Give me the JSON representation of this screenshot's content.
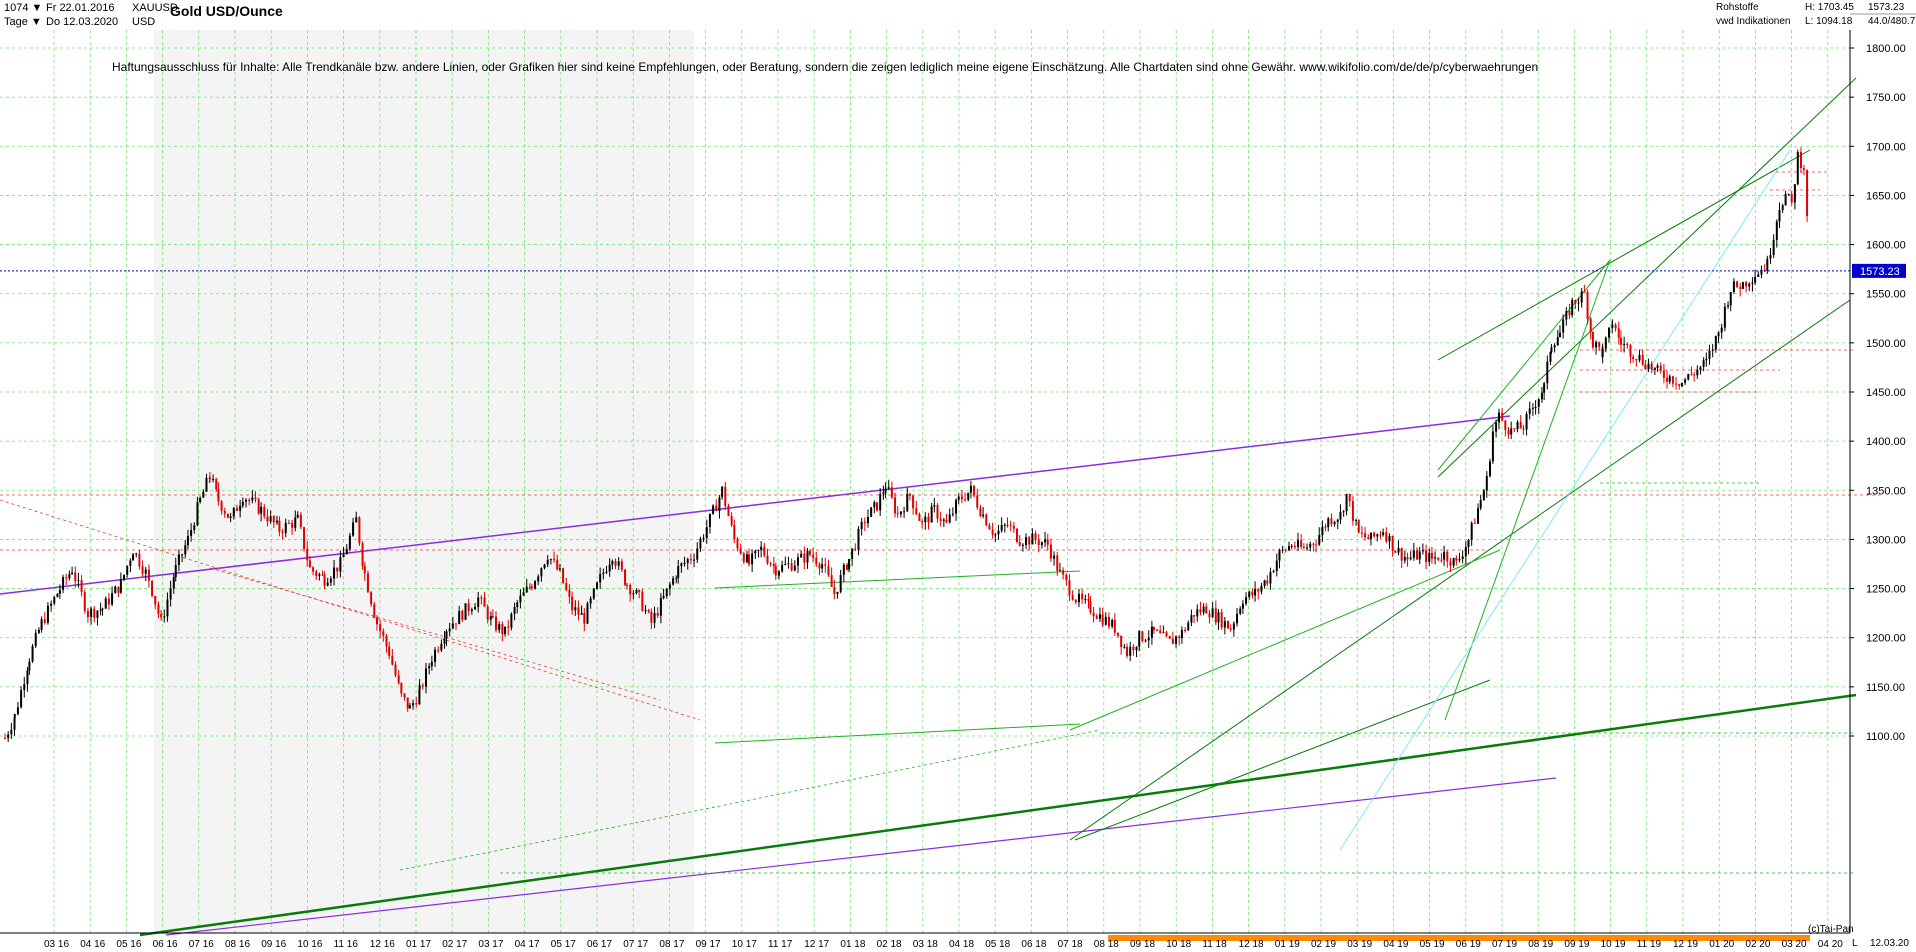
{
  "header": {
    "left": {
      "period": "1074",
      "interval": "Tage",
      "start_date": "Fr 22.01.2016",
      "end_date": "Do 12.03.2020",
      "symbol": "XAUUSD",
      "currency": "USD"
    },
    "title": "Gold USD/Ounce",
    "right": {
      "group": "Rohstoffe",
      "source": "vwd Indikationen",
      "high": "H: 1703.45",
      "low": "L: 1094.18",
      "last": "1573.23",
      "change": "44.0/480.7"
    }
  },
  "disclaimer": "Haftungsausschluss für Inhalte: Alle Trendkanäle bzw. andere Linien, oder Grafiken hier sind keine Empfehlungen, oder Beratung, sondern die zeigen lediglich meine eigene Einschätzung. Alle Chartdaten sind ohne Gewähr.  www.wikifolio.com/de/de/p/cyberwaehrungen",
  "copyright": "(c)Tai-Pan",
  "footer_date": "12.03.20",
  "axis_end_letter": "L",
  "colors": {
    "up": "#000000",
    "down": "#e00000",
    "grid": "#7ddc7d",
    "last_price_line": "#0000cc",
    "last_price_badge": "#0000cc",
    "purple": "#8b2be2",
    "green_dark": "#0a7a0a",
    "green": "#20b020",
    "cyan": "#80e8ff",
    "red_dashed": "#e04040",
    "orange_bar": "#ff8c00"
  },
  "chart_data": {
    "type": "candlestick",
    "title": "Gold USD/Ounce",
    "ylim": [
      1094.18,
      1820
    ],
    "y_ticks": [
      1100,
      1150,
      1200,
      1250,
      1300,
      1350,
      1400,
      1450,
      1500,
      1550,
      1600,
      1650,
      1700,
      1750,
      1800
    ],
    "y_tick_labels": [
      "1100.00",
      "1150.00",
      "1200.00",
      "1250.00",
      "1300.00",
      "1350.00",
      "1400.00",
      "1450.00",
      "1500.00",
      "1550.00",
      "1600.00",
      "1650.00",
      "1700.00",
      "1750.00",
      "1800.00"
    ],
    "x_tick_labels": [
      "03 16",
      "04 16",
      "05 16",
      "06 16",
      "07 16",
      "08 16",
      "09 16",
      "10 16",
      "11 16",
      "12 16",
      "01 17",
      "02 17",
      "03 17",
      "04 17",
      "05 17",
      "06 17",
      "07 17",
      "08 17",
      "09 17",
      "10 17",
      "11 17",
      "12 17",
      "01 18",
      "02 18",
      "03 18",
      "04 18",
      "05 18",
      "06 18",
      "07 18",
      "08 18",
      "09 18",
      "10 18",
      "11 18",
      "12 18",
      "01 19",
      "02 19",
      "03 19",
      "04 19",
      "05 19",
      "06 19",
      "07 19",
      "08 19",
      "09 19",
      "10 19",
      "11 19",
      "12 19",
      "01 20",
      "02 20",
      "03 20",
      "04 20"
    ],
    "last_price": 1573.23,
    "last_price_label": "1573.23",
    "high": 1703.45,
    "low": 1094.18,
    "price_path": [
      [
        0,
        1098
      ],
      [
        8,
        1120
      ],
      [
        20,
        1180
      ],
      [
        30,
        1215
      ],
      [
        45,
        1250
      ],
      [
        55,
        1270
      ],
      [
        68,
        1225
      ],
      [
        80,
        1230
      ],
      [
        95,
        1255
      ],
      [
        105,
        1290
      ],
      [
        118,
        1260
      ],
      [
        128,
        1215
      ],
      [
        140,
        1270
      ],
      [
        150,
        1300
      ],
      [
        160,
        1340
      ],
      [
        168,
        1365
      ],
      [
        175,
        1340
      ],
      [
        185,
        1320
      ],
      [
        195,
        1345
      ],
      [
        210,
        1330
      ],
      [
        225,
        1310
      ],
      [
        240,
        1320
      ],
      [
        250,
        1270
      ],
      [
        262,
        1260
      ],
      [
        275,
        1275
      ],
      [
        288,
        1320
      ],
      [
        295,
        1265
      ],
      [
        305,
        1215
      ],
      [
        315,
        1185
      ],
      [
        325,
        1140
      ],
      [
        332,
        1128
      ],
      [
        340,
        1145
      ],
      [
        350,
        1180
      ],
      [
        362,
        1210
      ],
      [
        375,
        1225
      ],
      [
        388,
        1240
      ],
      [
        400,
        1215
      ],
      [
        410,
        1205
      ],
      [
        420,
        1235
      ],
      [
        432,
        1255
      ],
      [
        445,
        1285
      ],
      [
        455,
        1265
      ],
      [
        465,
        1230
      ],
      [
        475,
        1220
      ],
      [
        488,
        1260
      ],
      [
        498,
        1285
      ],
      [
        510,
        1255
      ],
      [
        520,
        1240
      ],
      [
        530,
        1215
      ],
      [
        540,
        1240
      ],
      [
        552,
        1270
      ],
      [
        565,
        1285
      ],
      [
        578,
        1320
      ],
      [
        588,
        1350
      ],
      [
        598,
        1300
      ],
      [
        610,
        1275
      ],
      [
        620,
        1290
      ],
      [
        632,
        1270
      ],
      [
        645,
        1275
      ],
      [
        660,
        1285
      ],
      [
        670,
        1275
      ],
      [
        680,
        1245
      ],
      [
        692,
        1280
      ],
      [
        705,
        1320
      ],
      [
        715,
        1335
      ],
      [
        722,
        1355
      ],
      [
        732,
        1325
      ],
      [
        742,
        1345
      ],
      [
        752,
        1315
      ],
      [
        762,
        1330
      ],
      [
        772,
        1315
      ],
      [
        782,
        1340
      ],
      [
        792,
        1350
      ],
      [
        802,
        1325
      ],
      [
        812,
        1305
      ],
      [
        822,
        1315
      ],
      [
        832,
        1300
      ],
      [
        845,
        1300
      ],
      [
        855,
        1295
      ],
      [
        865,
        1265
      ],
      [
        878,
        1240
      ],
      [
        890,
        1230
      ],
      [
        900,
        1220
      ],
      [
        910,
        1210
      ],
      [
        920,
        1185
      ],
      [
        930,
        1200
      ],
      [
        942,
        1205
      ],
      [
        955,
        1195
      ],
      [
        965,
        1205
      ],
      [
        975,
        1225
      ],
      [
        985,
        1230
      ],
      [
        995,
        1220
      ],
      [
        1005,
        1210
      ],
      [
        1015,
        1240
      ],
      [
        1025,
        1245
      ],
      [
        1035,
        1260
      ],
      [
        1045,
        1285
      ],
      [
        1055,
        1295
      ],
      [
        1065,
        1290
      ],
      [
        1075,
        1300
      ],
      [
        1085,
        1320
      ],
      [
        1095,
        1325
      ],
      [
        1100,
        1345
      ],
      [
        1110,
        1305
      ],
      [
        1120,
        1300
      ],
      [
        1130,
        1310
      ],
      [
        1140,
        1290
      ],
      [
        1150,
        1280
      ],
      [
        1160,
        1285
      ],
      [
        1170,
        1280
      ],
      [
        1180,
        1285
      ],
      [
        1190,
        1275
      ],
      [
        1200,
        1300
      ],
      [
        1210,
        1340
      ],
      [
        1215,
        1360
      ],
      [
        1220,
        1410
      ],
      [
        1225,
        1425
      ],
      [
        1235,
        1410
      ],
      [
        1245,
        1415
      ],
      [
        1255,
        1440
      ],
      [
        1262,
        1455
      ],
      [
        1268,
        1500
      ],
      [
        1275,
        1510
      ],
      [
        1285,
        1540
      ],
      [
        1295,
        1550
      ],
      [
        1302,
        1500
      ],
      [
        1310,
        1490
      ],
      [
        1318,
        1520
      ],
      [
        1325,
        1500
      ],
      [
        1335,
        1490
      ],
      [
        1345,
        1480
      ],
      [
        1355,
        1470
      ],
      [
        1365,
        1465
      ],
      [
        1375,
        1460
      ],
      [
        1385,
        1470
      ],
      [
        1395,
        1480
      ],
      [
        1405,
        1510
      ],
      [
        1415,
        1555
      ],
      [
        1425,
        1560
      ],
      [
        1435,
        1570
      ],
      [
        1445,
        1580
      ],
      [
        1455,
        1640
      ],
      [
        1460,
        1650
      ],
      [
        1465,
        1640
      ],
      [
        1470,
        1690
      ],
      [
        1475,
        1680
      ],
      [
        1480,
        1573
      ]
    ]
  }
}
